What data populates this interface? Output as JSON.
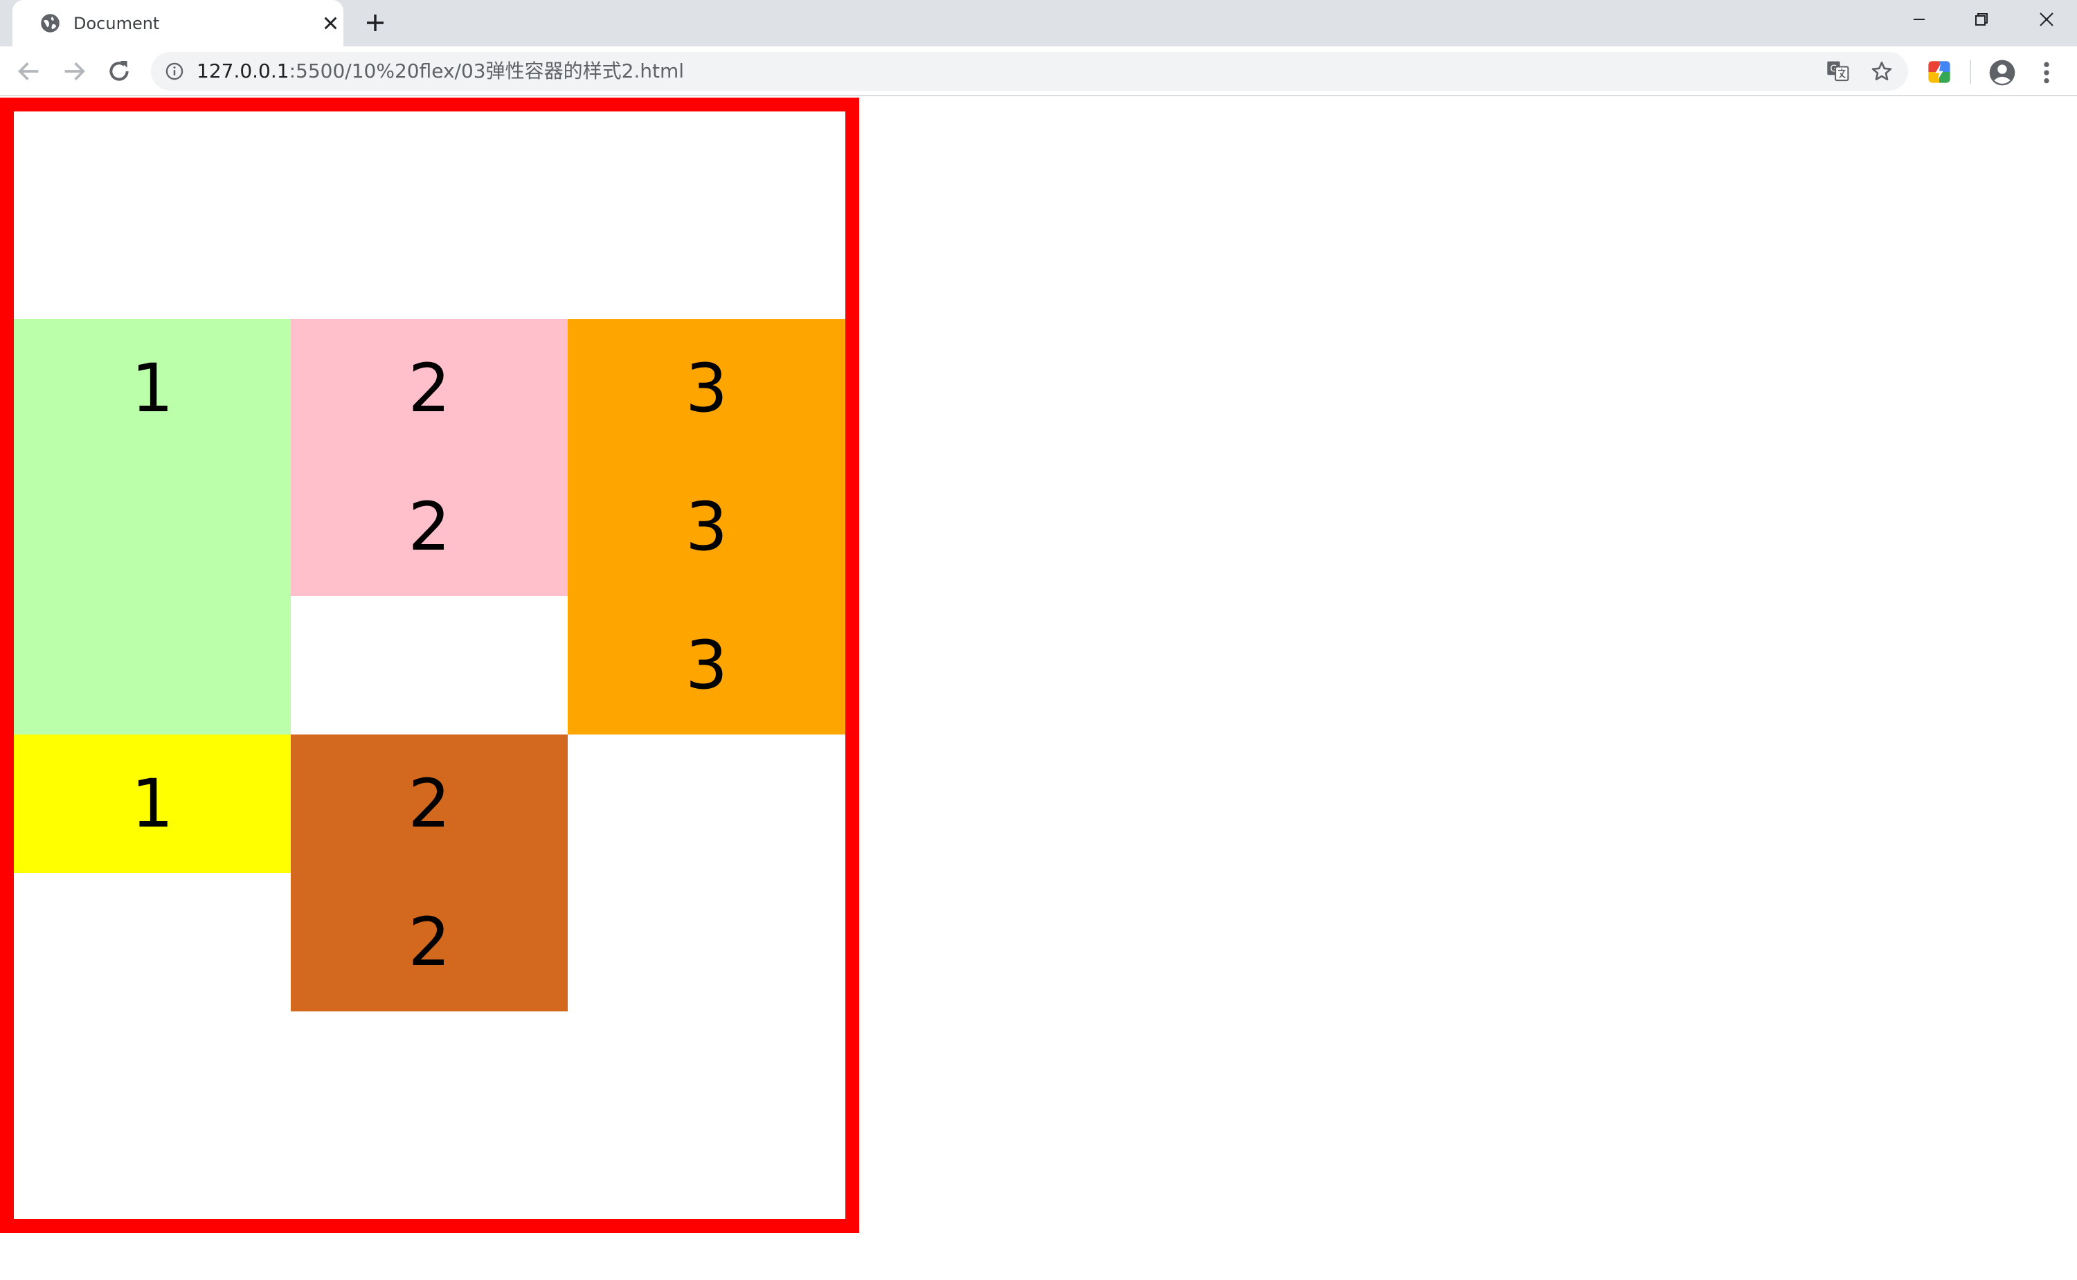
{
  "browser": {
    "tab": {
      "title": "Document",
      "favicon": "globe-icon",
      "close": "close-icon"
    },
    "new_tab": "plus-icon",
    "window_controls": [
      "minimize-icon",
      "restore-icon",
      "close-icon"
    ],
    "toolbar": {
      "back": "arrow-left-icon",
      "forward": "arrow-right-icon",
      "reload": "reload-icon",
      "site_info": "info-icon",
      "url_host": "127.0.0.1",
      "url_rest": ":5500/10%20flex/03弹性容器的样式2.html",
      "translate": "translate-icon",
      "bookmark": "star-icon",
      "extension": "extension-icon",
      "profile": "profile-icon",
      "menu": "kebab-menu-icon"
    }
  },
  "page": {
    "container_border_color": "#ff0000",
    "items": [
      {
        "lines": [
          "1"
        ],
        "color": "#bbffaa"
      },
      {
        "lines": [
          "2",
          "2"
        ],
        "color": "#ffc0cb"
      },
      {
        "lines": [
          "3",
          "3",
          "3"
        ],
        "color": "#ffa500"
      },
      {
        "lines": [
          "1"
        ],
        "color": "#ffff00"
      },
      {
        "lines": [
          "2",
          "2"
        ],
        "color": "#d2691e"
      }
    ]
  }
}
